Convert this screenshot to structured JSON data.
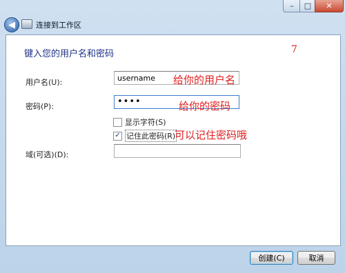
{
  "window": {
    "minimize_glyph": "–",
    "maximize_glyph": "□",
    "close_glyph": "✕"
  },
  "nav": {
    "back_glyph": "◀",
    "title": "连接到工作区"
  },
  "form": {
    "heading": "键入您的用户名和密码",
    "username_label": "用户名(U):",
    "username_value": "username",
    "password_label": "密码(P):",
    "password_value": "pass",
    "show_chars_label": "显示字符(S)",
    "show_chars_checked": false,
    "remember_label": "记住此密码(R)",
    "remember_checked": true,
    "check_glyph": "✓",
    "domain_label": "域(可选)(D):",
    "domain_value": ""
  },
  "annotations": {
    "number": "7",
    "username_note": "给你的用户名",
    "password_note": "给你的密码",
    "remember_note": "可以记住密码哦"
  },
  "buttons": {
    "ok_label": "创建(C)",
    "cancel_label": "取消"
  },
  "colors": {
    "heading": "#1e3287",
    "annotation": "#e01e1e",
    "chrome": "#c5d9ee"
  }
}
